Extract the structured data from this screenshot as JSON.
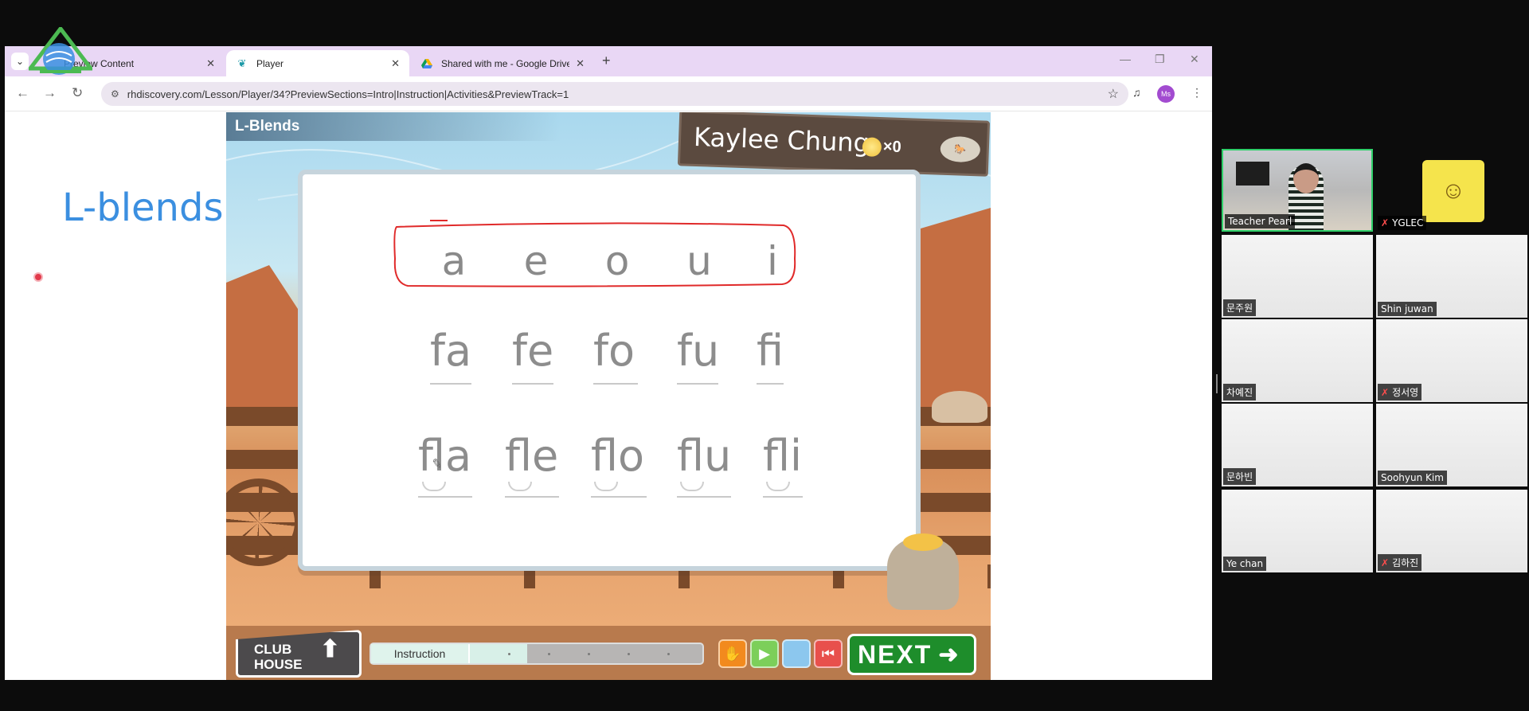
{
  "browser": {
    "tabs": [
      {
        "title": "Preview Content",
        "favicon": "logo-icon",
        "active": false
      },
      {
        "title": "Player",
        "favicon": "butterfly-icon",
        "active": true
      },
      {
        "title": "Shared with me - Google Drive",
        "favicon": "drive-icon",
        "active": false
      }
    ],
    "url": "rhdiscovery.com/Lesson/Player/34?PreviewSections=Intro|Instruction|Activities&PreviewTrack=1",
    "profile_initials": "Ms",
    "profile_color": "#a24bd0"
  },
  "page": {
    "heading": "L-blends",
    "heading_color": "#3b8fe0"
  },
  "game": {
    "title": "L-Blends",
    "player_name": "Kaylee Chung",
    "coin_count": "×0",
    "row_vowels": [
      "a",
      "e",
      "o",
      "u",
      "i"
    ],
    "row_f": [
      "fa",
      "fe",
      "fo",
      "fu",
      "fi"
    ],
    "row_fl": [
      "fla",
      "fle",
      "flo",
      "flu",
      "fli"
    ],
    "bottom": {
      "clubhouse_line1": "CLUB",
      "clubhouse_line2": "HOUSE",
      "progress_label": "Instruction",
      "progress_fraction": 0.47,
      "next_label": "NEXT"
    },
    "accent_green": "#1e8d2b",
    "ink_color": "#e02a2a"
  },
  "meeting": {
    "participants": [
      {
        "name": "Teacher Pearl",
        "muted": false,
        "speaking": true
      },
      {
        "name": "YGLEC",
        "muted": true,
        "speaking": false
      },
      {
        "name": "문주원",
        "muted": false,
        "speaking": false
      },
      {
        "name": "Shin juwan",
        "muted": false,
        "speaking": false
      },
      {
        "name": "차예진",
        "muted": false,
        "speaking": false
      },
      {
        "name": "정서영",
        "muted": true,
        "speaking": false
      },
      {
        "name": "문하빈",
        "muted": false,
        "speaking": false
      },
      {
        "name": "Soohyun Kim",
        "muted": false,
        "speaking": false
      },
      {
        "name": "Ye chan",
        "muted": false,
        "speaking": false
      },
      {
        "name": "김하진",
        "muted": true,
        "speaking": false
      }
    ]
  }
}
